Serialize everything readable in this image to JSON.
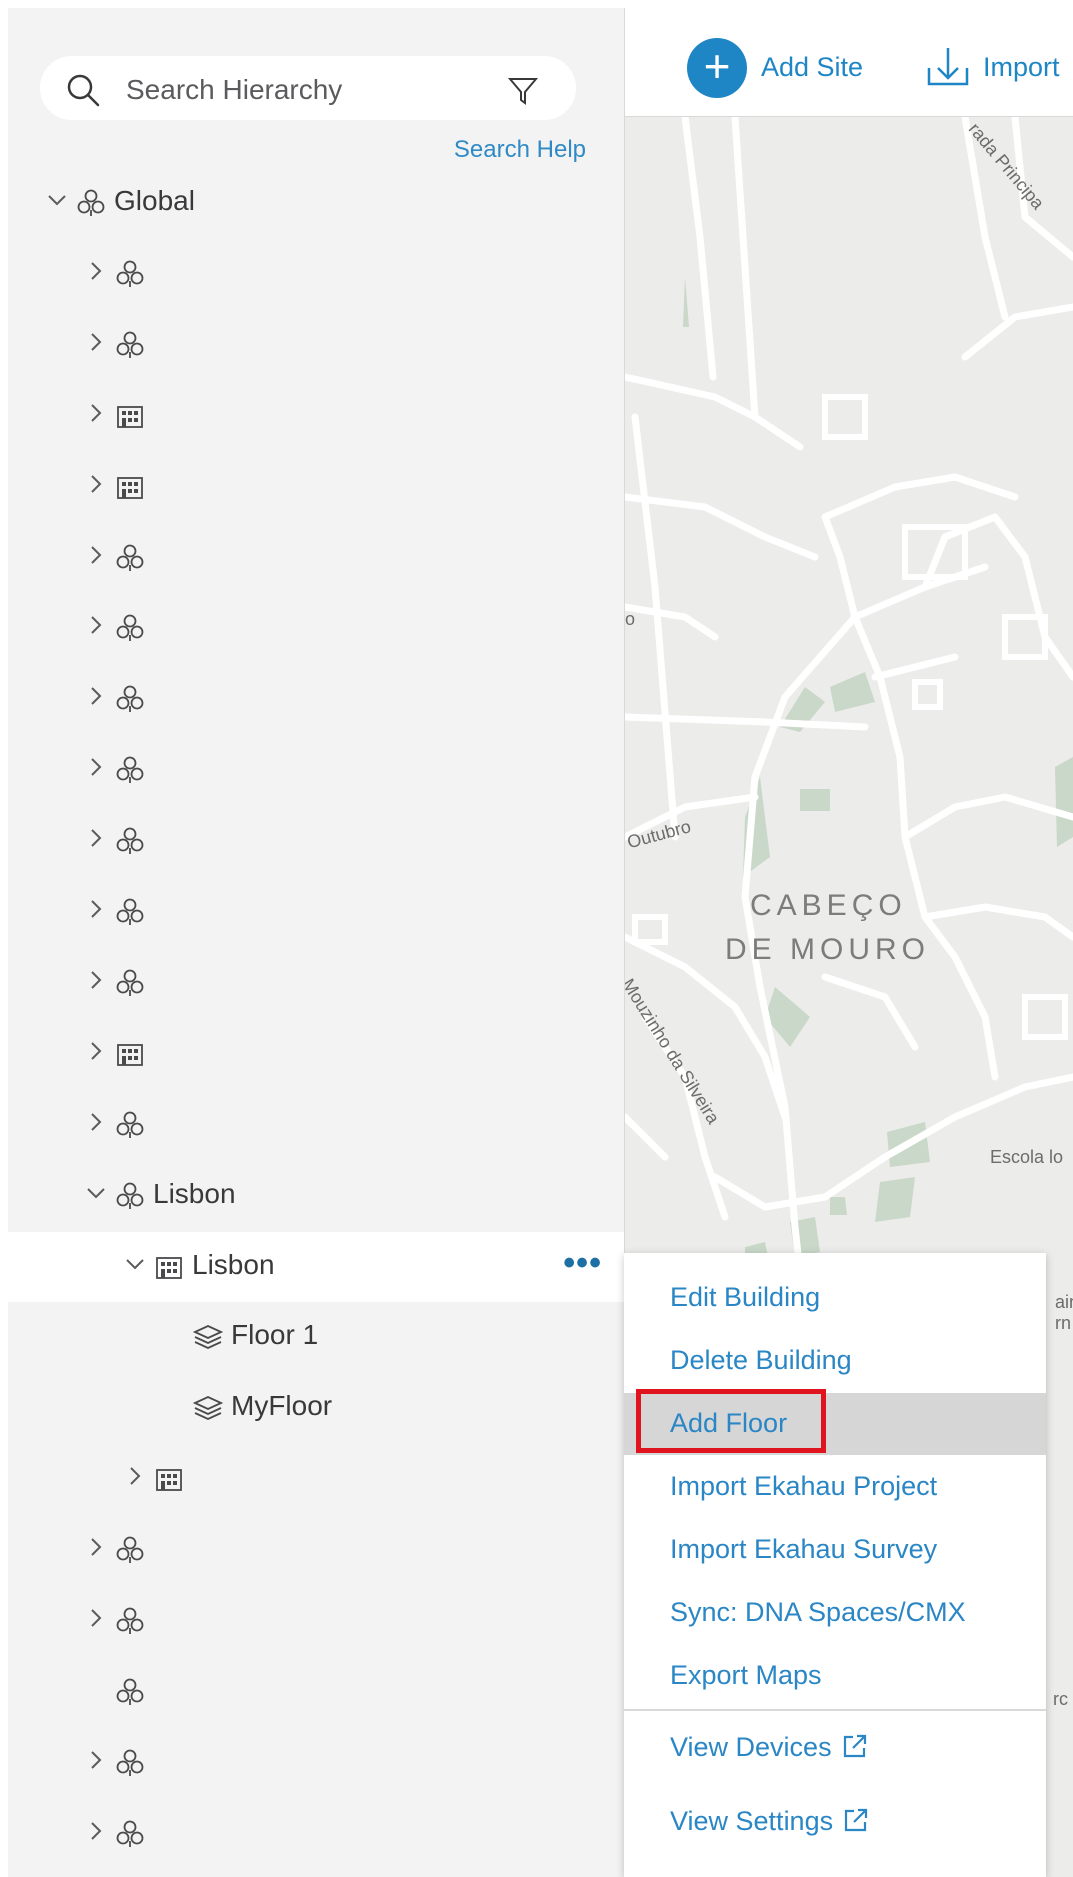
{
  "search": {
    "placeholder": "Search Hierarchy",
    "help_link": "Search Help"
  },
  "toolbar": {
    "add_site_label": "Add Site",
    "import_label": "Import"
  },
  "tree": [
    {
      "level": 0,
      "chevron": "down",
      "icon": "area",
      "label": "Global"
    },
    {
      "level": 1,
      "chevron": "right",
      "icon": "area",
      "label": ""
    },
    {
      "level": 1,
      "chevron": "right",
      "icon": "area",
      "label": ""
    },
    {
      "level": 1,
      "chevron": "right",
      "icon": "building",
      "label": ""
    },
    {
      "level": 1,
      "chevron": "right",
      "icon": "building",
      "label": ""
    },
    {
      "level": 1,
      "chevron": "right",
      "icon": "area",
      "label": ""
    },
    {
      "level": 1,
      "chevron": "right",
      "icon": "area",
      "label": ""
    },
    {
      "level": 1,
      "chevron": "right",
      "icon": "area",
      "label": ""
    },
    {
      "level": 1,
      "chevron": "right",
      "icon": "area",
      "label": ""
    },
    {
      "level": 1,
      "chevron": "right",
      "icon": "area",
      "label": ""
    },
    {
      "level": 1,
      "chevron": "right",
      "icon": "area",
      "label": ""
    },
    {
      "level": 1,
      "chevron": "right",
      "icon": "area",
      "label": ""
    },
    {
      "level": 1,
      "chevron": "right",
      "icon": "building",
      "label": ""
    },
    {
      "level": 1,
      "chevron": "right",
      "icon": "area",
      "label": ""
    },
    {
      "level": 1,
      "chevron": "down",
      "icon": "area",
      "label": "Lisbon"
    },
    {
      "level": 2,
      "chevron": "down",
      "icon": "building",
      "label": "Lisbon",
      "selected": true
    },
    {
      "level": 3,
      "chevron": "none",
      "icon": "floor",
      "label": "Floor 1"
    },
    {
      "level": 3,
      "chevron": "none",
      "icon": "floor",
      "label": "MyFloor"
    },
    {
      "level": 2,
      "chevron": "right",
      "icon": "building",
      "label": ""
    },
    {
      "level": 1,
      "chevron": "right",
      "icon": "area",
      "label": ""
    },
    {
      "level": 1,
      "chevron": "right",
      "icon": "area",
      "label": ""
    },
    {
      "level": 1,
      "chevron": "none",
      "icon": "area",
      "label": ""
    },
    {
      "level": 1,
      "chevron": "right",
      "icon": "area",
      "label": ""
    },
    {
      "level": 1,
      "chevron": "right",
      "icon": "area",
      "label": ""
    }
  ],
  "map": {
    "area_label_line1": "CABEÇO",
    "area_label_line2": "DE MOURO",
    "streets": [
      "rada Principa",
      "Outubro",
      "Mouzinho da Silveira",
      "Escola lo",
      "ain",
      "rn",
      "rc",
      "o"
    ]
  },
  "menu": {
    "items": [
      {
        "label": "Edit Building"
      },
      {
        "label": "Delete Building"
      },
      {
        "label": "Add Floor",
        "active": true
      },
      {
        "label": "Import Ekahau Project"
      },
      {
        "label": "Import Ekahau Survey"
      },
      {
        "label": "Sync: DNA Spaces/CMX"
      },
      {
        "label": "Export Maps"
      }
    ],
    "links": [
      {
        "label": "View Devices",
        "icon": "external-link-icon"
      },
      {
        "label": "View Settings",
        "icon": "external-link-icon"
      }
    ]
  },
  "colors": {
    "accent": "#1f86c6",
    "highlight_border": "#e0141e",
    "sidebar_bg": "#f3f3f3"
  }
}
